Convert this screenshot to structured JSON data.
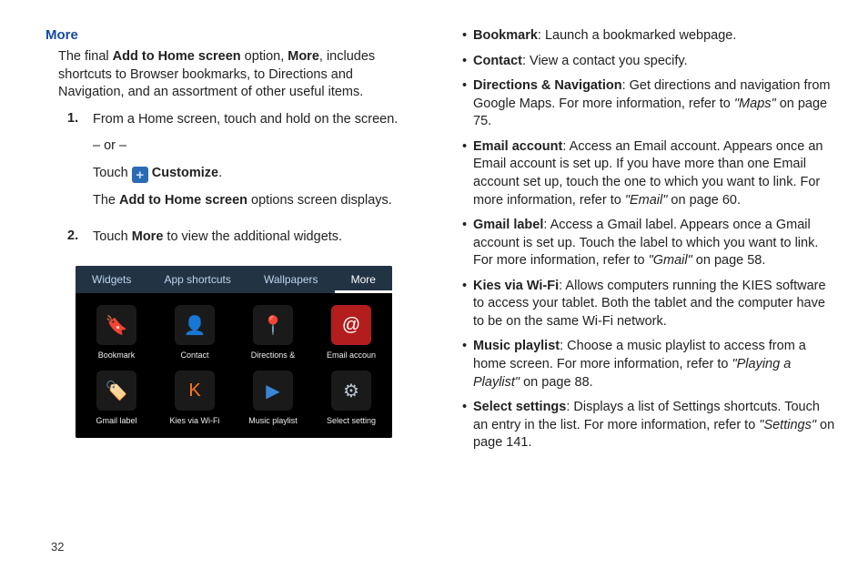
{
  "pageNumber": "32",
  "left": {
    "heading": "More",
    "intro_1": "The final ",
    "intro_b1": "Add to Home screen",
    "intro_2": " option, ",
    "intro_b2": "More",
    "intro_3": ", includes shortcuts to Browser bookmarks, to Directions and Navigation, and an assortment of other useful items.",
    "steps": [
      {
        "num": "1.",
        "line1": "From a Home screen, touch and hold on the screen.",
        "or": "– or –",
        "touch": "Touch  ",
        "customize": "Customize",
        "touch_end": ".",
        "result_1": "The ",
        "result_b": "Add to Home screen",
        "result_2": " options screen displays."
      },
      {
        "num": "2.",
        "line1a": "Touch ",
        "line1b": "More",
        "line1c": " to view the additional widgets."
      }
    ],
    "panel": {
      "tabs": [
        "Widgets",
        "App shortcuts",
        "Wallpapers",
        "More"
      ],
      "apps": [
        {
          "label": "Bookmark",
          "bg": "#1a1a1a",
          "glyph": "🔖",
          "gcolor": "#d5332a"
        },
        {
          "label": "Contact",
          "bg": "#1a1a1a",
          "glyph": "👤",
          "gcolor": "#e5e5e5"
        },
        {
          "label": "Directions & ",
          "bg": "#1a1a1a",
          "glyph": "📍",
          "gcolor": "#CE4531"
        },
        {
          "label": "Email accoun",
          "bg": "#b31d1d",
          "glyph": "@",
          "gcolor": "#fff"
        },
        {
          "label": "Gmail label",
          "bg": "#1a1a1a",
          "glyph": "🏷️",
          "gcolor": "#c93a2b"
        },
        {
          "label": "Kies via Wi-Fi",
          "bg": "#1a1a1a",
          "glyph": "K",
          "gcolor": "#ff7a1a"
        },
        {
          "label": "Music playlist",
          "bg": "#1a1a1a",
          "glyph": "▶",
          "gcolor": "#3a85d6"
        },
        {
          "label": "Select setting",
          "bg": "#1a1a1a",
          "glyph": "⚙",
          "gcolor": "#b8c4cf"
        }
      ]
    }
  },
  "right": {
    "items": [
      {
        "term": "Bookmark",
        "sep": ": ",
        "text": "Launch a bookmarked webpage."
      },
      {
        "term": "Contact",
        "sep": ": ",
        "text": "View a contact you specify."
      },
      {
        "term": "Directions & Navigation",
        "sep": ": ",
        "text": "Get directions and navigation from Google Maps. For more information, refer to ",
        "ref": "\"Maps\"",
        "tail": "  on page 75."
      },
      {
        "term": "Email account",
        "sep": ": ",
        "text": "Access an Email account. Appears once an Email account is set up. If you have more than one Email account set up, touch the one to which you want to link. For more information, refer to ",
        "ref": "\"Email\"",
        "tail": "  on page 60."
      },
      {
        "term": "Gmail label",
        "sep": ": ",
        "text": "Access a Gmail label. Appears once a Gmail account is set up. Touch the label to which you want to link. For more information, refer to ",
        "ref": "\"Gmail\"",
        "tail": "  on page 58."
      },
      {
        "term": "Kies via Wi-Fi",
        "sep": ": ",
        "text": "Allows computers running the KIES software to access your tablet. Both the tablet and the computer have to be on the same Wi-Fi network."
      },
      {
        "term": "Music playlist",
        "sep": ": ",
        "text": "Choose a music playlist to access from a home screen. For more information, refer to ",
        "ref": "\"Playing a Playlist\"",
        "tail": "  on page 88."
      },
      {
        "term": "Select settings",
        "sep": ": ",
        "text": "Displays a list of Settings shortcuts. Touch an entry in the list. For more information, refer to ",
        "ref": "\"Settings\"",
        "tail": "  on page 141."
      }
    ]
  }
}
